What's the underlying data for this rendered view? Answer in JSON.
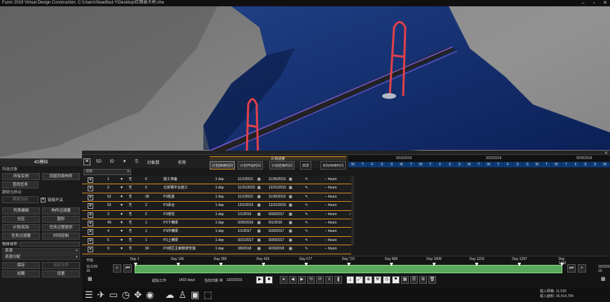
{
  "window": {
    "title": "Fuzor 2019 Virtual Design Construction: C:\\Users\\Steadfast-Y\\Desktop\\红图悬大桥.che",
    "controls": [
      "–",
      "▫",
      "✕"
    ]
  },
  "left_panel": {
    "title": "4D模拟",
    "section_selection": "所选对象",
    "buttons_row1": [
      "所有实例",
      "同层同类构件"
    ],
    "button_find_task": "查找任务",
    "section_nav": "跟随当移动",
    "follow_btn": "跟随当前",
    "link_switch": "链接开关",
    "buttons_row3": [
      "列表编辑",
      "构件过滤器"
    ],
    "buttons_row4": [
      "分区",
      "图形"
    ],
    "buttons_row5": [
      "计划/实际",
      "任务过程提供"
    ],
    "buttons_row6": [
      "任务过滤器",
      "时间控制"
    ],
    "object_volume": "物体体积",
    "bar_resource": "资源",
    "bar_alloc": "资源分配",
    "buttons_row7": [
      "保存",
      "另存文件"
    ],
    "buttons_row8": [
      "加载",
      "设置"
    ]
  },
  "grid": {
    "toolbar": {
      "mode": "5D",
      "id": "ID",
      "objects": "对象数",
      "name": "名称"
    },
    "plan_header": "计划进度",
    "columns": [
      "计划持续时间",
      "计划开始时间",
      "计划结束时间",
      "高层",
      "实际持续时间"
    ],
    "search_placeholder": "搜索",
    "rows": [
      {
        "id": "1",
        "count": "0",
        "name": "施工准备",
        "dur": "1 day",
        "start": "11/1/2015",
        "end": "11/30/2015",
        "hours": "-- hours"
      },
      {
        "id": "2",
        "count": "0",
        "name": "北岸钢平台施工",
        "dur": "1 day",
        "start": "11/21/2015",
        "end": "12/31/2015",
        "hours": "-- hours"
      },
      {
        "id": "52",
        "count": "38",
        "name": "P3桩基",
        "dur": "1 day",
        "start": "11/1/2015",
        "end": "11/30/2015",
        "hours": "-- hours"
      },
      {
        "id": "53",
        "count": "2",
        "name": "P3承台",
        "dur": "1 day",
        "start": "12/1/2015",
        "end": "12/31/2015",
        "hours": "-- hours"
      },
      {
        "id": "3",
        "count": "2",
        "name": "P3塔柱",
        "dur": "1 day",
        "start": "1/1/2016",
        "end": "9/30/2017",
        "hours": "-- hours"
      },
      {
        "id": "49",
        "count": "1",
        "name": "P3下横梁",
        "dur": "1 day",
        "start": "3/30/2016",
        "end": "9/1/2016",
        "hours": "-- hours"
      },
      {
        "id": "4",
        "count": "1",
        "name": "P3中横梁",
        "dur": "1 day",
        "start": "1/1/2017",
        "end": "5/30/2017",
        "hours": "-- hours"
      },
      {
        "id": "5",
        "count": "1",
        "name": "P3上横梁",
        "dur": "1 day",
        "start": "9/21/2017",
        "end": "9/30/2017",
        "hours": "-- hours"
      },
      {
        "id": "9",
        "count": "90",
        "name": "P3塔区主索鞍架安装",
        "dur": "1 day",
        "start": "3/8/2018",
        "end": "4/29/2018",
        "hours": "-- hours"
      }
    ]
  },
  "gantt": {
    "weeks": [
      "9/15/2019",
      "9/22/2019",
      "9/29/2019"
    ],
    "days": [
      "W",
      "T",
      "F",
      "S",
      "S",
      "M",
      "T",
      "W",
      "T",
      "F",
      "S",
      "S",
      "M",
      "T",
      "W",
      "T",
      "F",
      "S",
      "S",
      "M",
      "T",
      "W",
      "T",
      "F",
      "S",
      "S",
      "M"
    ]
  },
  "timeline": {
    "start_label": "开始",
    "start_date": "11/1/20\n15",
    "end_date": "10/2/20\n19",
    "day_labels": [
      "Day 1",
      "Day 145",
      "Day 289",
      "Day 433",
      "Day 577",
      "Day 721",
      "Day 865",
      "Day 1009",
      "Day 1153",
      "Day 1297",
      "Day 1432"
    ],
    "work_label": "起始工作",
    "work_value": "1432 days",
    "current_label": "当前日期",
    "current_value": "10/2/2019"
  },
  "stats": {
    "visible_faces_label": "载入网格",
    "visible_faces_value": "11,539",
    "total_faces_label": "载入面积",
    "total_faces_value": "35,414,784"
  }
}
